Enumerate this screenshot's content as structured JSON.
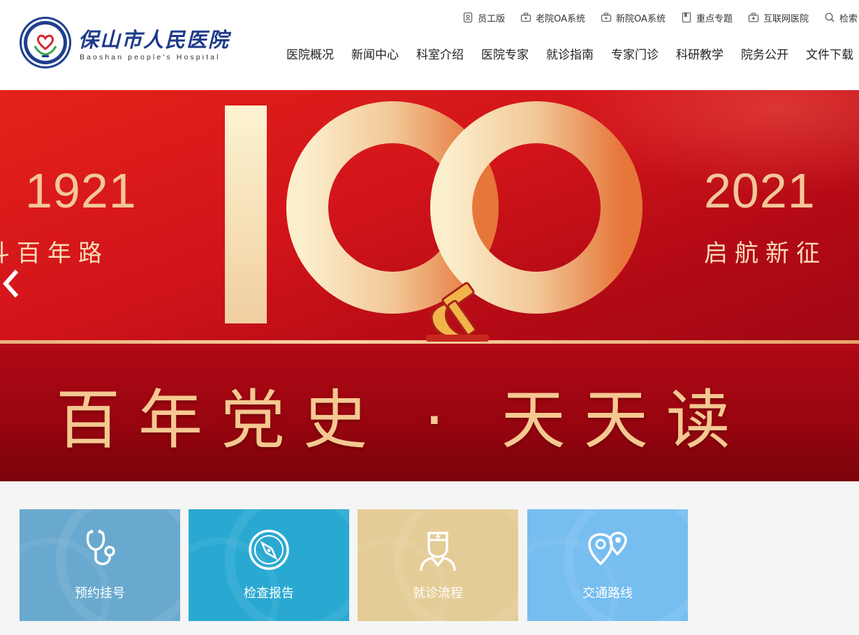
{
  "header": {
    "logo_cn": "保山市人民医院",
    "logo_en": "Baoshan people's Hospital",
    "top_links": [
      {
        "label": "员工版",
        "icon": "badge-icon"
      },
      {
        "label": "老院OA系统",
        "icon": "briefcase-icon"
      },
      {
        "label": "新院OA系统",
        "icon": "briefcase-icon"
      },
      {
        "label": "重点专题",
        "icon": "bookmark-icon"
      },
      {
        "label": "互联网医院",
        "icon": "medical-kit-icon"
      },
      {
        "label": "检索",
        "icon": "search-icon"
      }
    ],
    "nav": [
      "医院概况",
      "新闻中心",
      "科室介绍",
      "医院专家",
      "就诊指南",
      "专家门诊",
      "科研教学",
      "院务公开",
      "文件下载"
    ]
  },
  "banner": {
    "year_left": "1921",
    "year_right": "2021",
    "sub_left": "斗百年路",
    "sub_right": "启航新征",
    "big_number": "100",
    "slogan": "百年党史 · 天天读",
    "prev_icon": "chevron-left-icon",
    "emblem_icon": "hammer-sickle-icon"
  },
  "tiles": [
    {
      "label": "预约挂号",
      "icon": "stethoscope-icon",
      "color": "#6aa9cf"
    },
    {
      "label": "检查报告",
      "icon": "compass-icon",
      "color": "#29a9d2"
    },
    {
      "label": "就诊流程",
      "icon": "doctor-icon",
      "color": "#e4cc96"
    },
    {
      "label": "交通路线",
      "icon": "map-pin-icon",
      "color": "#76bdf0"
    }
  ]
}
